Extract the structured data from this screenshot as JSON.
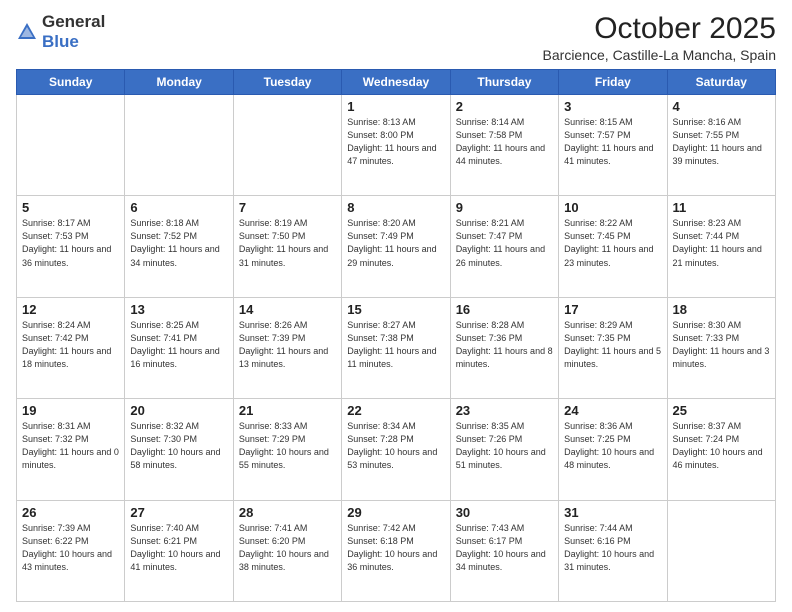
{
  "logo": {
    "general": "General",
    "blue": "Blue"
  },
  "header": {
    "month": "October 2025",
    "location": "Barcience, Castille-La Mancha, Spain"
  },
  "weekdays": [
    "Sunday",
    "Monday",
    "Tuesday",
    "Wednesday",
    "Thursday",
    "Friday",
    "Saturday"
  ],
  "weeks": [
    [
      {
        "day": "",
        "info": ""
      },
      {
        "day": "",
        "info": ""
      },
      {
        "day": "",
        "info": ""
      },
      {
        "day": "1",
        "info": "Sunrise: 8:13 AM\nSunset: 8:00 PM\nDaylight: 11 hours and 47 minutes."
      },
      {
        "day": "2",
        "info": "Sunrise: 8:14 AM\nSunset: 7:58 PM\nDaylight: 11 hours and 44 minutes."
      },
      {
        "day": "3",
        "info": "Sunrise: 8:15 AM\nSunset: 7:57 PM\nDaylight: 11 hours and 41 minutes."
      },
      {
        "day": "4",
        "info": "Sunrise: 8:16 AM\nSunset: 7:55 PM\nDaylight: 11 hours and 39 minutes."
      }
    ],
    [
      {
        "day": "5",
        "info": "Sunrise: 8:17 AM\nSunset: 7:53 PM\nDaylight: 11 hours and 36 minutes."
      },
      {
        "day": "6",
        "info": "Sunrise: 8:18 AM\nSunset: 7:52 PM\nDaylight: 11 hours and 34 minutes."
      },
      {
        "day": "7",
        "info": "Sunrise: 8:19 AM\nSunset: 7:50 PM\nDaylight: 11 hours and 31 minutes."
      },
      {
        "day": "8",
        "info": "Sunrise: 8:20 AM\nSunset: 7:49 PM\nDaylight: 11 hours and 29 minutes."
      },
      {
        "day": "9",
        "info": "Sunrise: 8:21 AM\nSunset: 7:47 PM\nDaylight: 11 hours and 26 minutes."
      },
      {
        "day": "10",
        "info": "Sunrise: 8:22 AM\nSunset: 7:45 PM\nDaylight: 11 hours and 23 minutes."
      },
      {
        "day": "11",
        "info": "Sunrise: 8:23 AM\nSunset: 7:44 PM\nDaylight: 11 hours and 21 minutes."
      }
    ],
    [
      {
        "day": "12",
        "info": "Sunrise: 8:24 AM\nSunset: 7:42 PM\nDaylight: 11 hours and 18 minutes."
      },
      {
        "day": "13",
        "info": "Sunrise: 8:25 AM\nSunset: 7:41 PM\nDaylight: 11 hours and 16 minutes."
      },
      {
        "day": "14",
        "info": "Sunrise: 8:26 AM\nSunset: 7:39 PM\nDaylight: 11 hours and 13 minutes."
      },
      {
        "day": "15",
        "info": "Sunrise: 8:27 AM\nSunset: 7:38 PM\nDaylight: 11 hours and 11 minutes."
      },
      {
        "day": "16",
        "info": "Sunrise: 8:28 AM\nSunset: 7:36 PM\nDaylight: 11 hours and 8 minutes."
      },
      {
        "day": "17",
        "info": "Sunrise: 8:29 AM\nSunset: 7:35 PM\nDaylight: 11 hours and 5 minutes."
      },
      {
        "day": "18",
        "info": "Sunrise: 8:30 AM\nSunset: 7:33 PM\nDaylight: 11 hours and 3 minutes."
      }
    ],
    [
      {
        "day": "19",
        "info": "Sunrise: 8:31 AM\nSunset: 7:32 PM\nDaylight: 11 hours and 0 minutes."
      },
      {
        "day": "20",
        "info": "Sunrise: 8:32 AM\nSunset: 7:30 PM\nDaylight: 10 hours and 58 minutes."
      },
      {
        "day": "21",
        "info": "Sunrise: 8:33 AM\nSunset: 7:29 PM\nDaylight: 10 hours and 55 minutes."
      },
      {
        "day": "22",
        "info": "Sunrise: 8:34 AM\nSunset: 7:28 PM\nDaylight: 10 hours and 53 minutes."
      },
      {
        "day": "23",
        "info": "Sunrise: 8:35 AM\nSunset: 7:26 PM\nDaylight: 10 hours and 51 minutes."
      },
      {
        "day": "24",
        "info": "Sunrise: 8:36 AM\nSunset: 7:25 PM\nDaylight: 10 hours and 48 minutes."
      },
      {
        "day": "25",
        "info": "Sunrise: 8:37 AM\nSunset: 7:24 PM\nDaylight: 10 hours and 46 minutes."
      }
    ],
    [
      {
        "day": "26",
        "info": "Sunrise: 7:39 AM\nSunset: 6:22 PM\nDaylight: 10 hours and 43 minutes."
      },
      {
        "day": "27",
        "info": "Sunrise: 7:40 AM\nSunset: 6:21 PM\nDaylight: 10 hours and 41 minutes."
      },
      {
        "day": "28",
        "info": "Sunrise: 7:41 AM\nSunset: 6:20 PM\nDaylight: 10 hours and 38 minutes."
      },
      {
        "day": "29",
        "info": "Sunrise: 7:42 AM\nSunset: 6:18 PM\nDaylight: 10 hours and 36 minutes."
      },
      {
        "day": "30",
        "info": "Sunrise: 7:43 AM\nSunset: 6:17 PM\nDaylight: 10 hours and 34 minutes."
      },
      {
        "day": "31",
        "info": "Sunrise: 7:44 AM\nSunset: 6:16 PM\nDaylight: 10 hours and 31 minutes."
      },
      {
        "day": "",
        "info": ""
      }
    ]
  ]
}
